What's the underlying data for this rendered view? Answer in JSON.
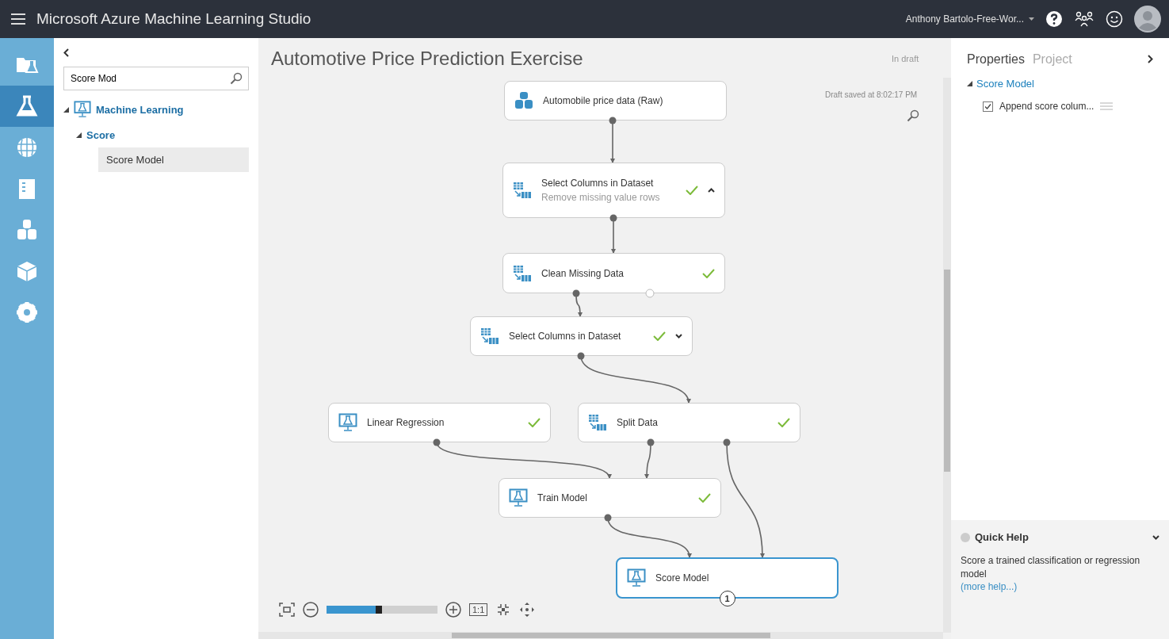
{
  "app_title": "Microsoft Azure Machine Learning Studio",
  "account": "Anthony Bartolo-Free-Wor...",
  "rail": [
    {
      "kind": "projects",
      "selected": false
    },
    {
      "kind": "experiments",
      "selected": true
    },
    {
      "kind": "web-services",
      "selected": false
    },
    {
      "kind": "notebooks",
      "selected": false
    },
    {
      "kind": "datasets",
      "selected": false
    },
    {
      "kind": "models",
      "selected": false
    },
    {
      "kind": "settings",
      "selected": false
    }
  ],
  "palette": {
    "search": {
      "value": "Score Mod"
    },
    "tree": [
      {
        "label": "Machine Learning",
        "expanded": true,
        "children": [
          {
            "label": "Score",
            "expanded": true,
            "children": [
              {
                "label": "Score Model",
                "selected": true
              }
            ]
          }
        ]
      }
    ]
  },
  "experiment": {
    "title": "Automotive Price Prediction Exercise",
    "status": "In draft",
    "saved": "Draft saved at 8:02:17 PM",
    "nodes": [
      {
        "label": "Automobile price data (Raw)",
        "kind": "dataset",
        "completed": false,
        "selected": false
      },
      {
        "label": "Select Columns in Dataset",
        "subtitle": "Remove missing value rows",
        "kind": "transform",
        "completed": true,
        "comment_expanded": true,
        "selected": false
      },
      {
        "label": "Clean Missing Data",
        "kind": "transform",
        "completed": true,
        "selected": false
      },
      {
        "label": "Select Columns in Dataset",
        "kind": "transform",
        "completed": true,
        "comment_expanded": false,
        "selected": false
      },
      {
        "label": "Linear Regression",
        "kind": "model",
        "completed": true,
        "selected": false
      },
      {
        "label": "Split Data",
        "kind": "transform",
        "completed": true,
        "selected": false
      },
      {
        "label": "Train Model",
        "kind": "model",
        "completed": true,
        "selected": false
      },
      {
        "label": "Score Model",
        "kind": "model",
        "completed": false,
        "selected": true,
        "badge": "1"
      }
    ],
    "zoom": {
      "level": 0.5,
      "actual_size": "1:1"
    }
  },
  "properties": {
    "tabs": [
      {
        "label": "Properties",
        "selected": true
      },
      {
        "label": "Project",
        "selected": false
      }
    ],
    "section": {
      "label": "Score Model",
      "expanded": true
    },
    "params": [
      {
        "label": "Append score colum...",
        "checked": true
      }
    ]
  },
  "quick_help": {
    "title": "Quick Help",
    "text": "Score a trained classification or regression model",
    "link": "(more help...)"
  }
}
